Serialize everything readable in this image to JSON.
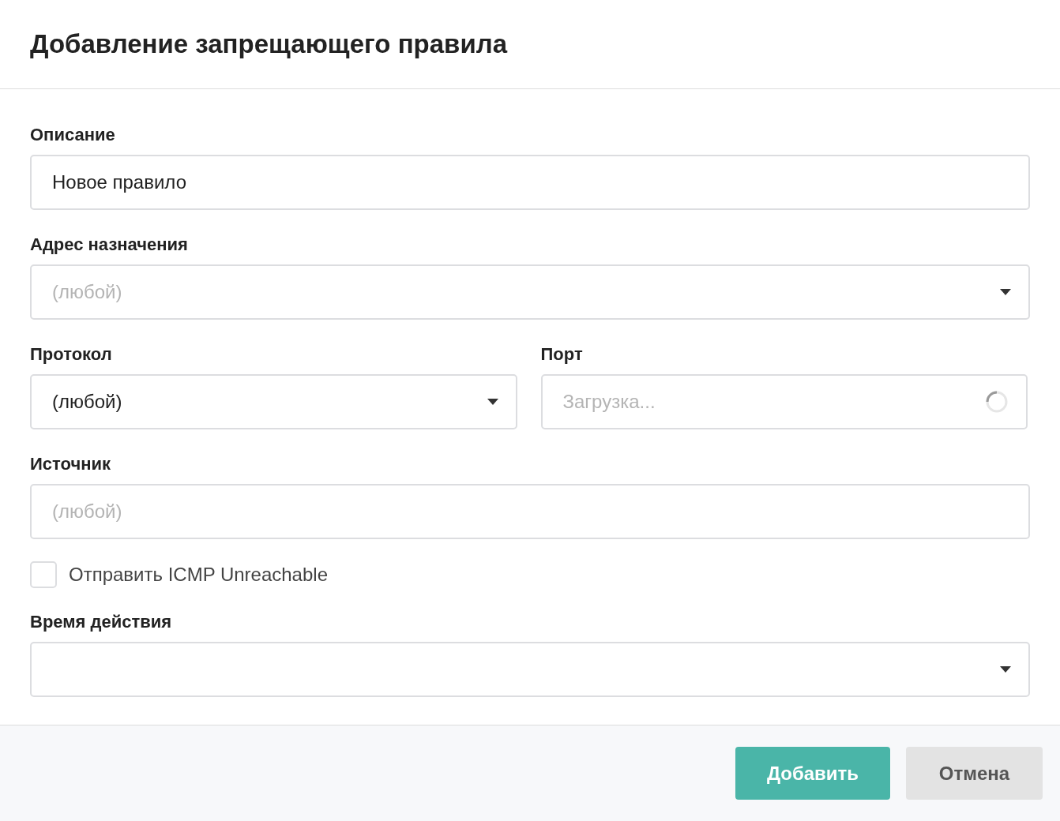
{
  "dialog": {
    "title": "Добавление запрещающего правила"
  },
  "form": [
    {
      "kind": "text",
      "label": "Описание",
      "value": "Новое правило"
    },
    {
      "kind": "select",
      "label": "Адрес назначения",
      "placeholder": "(любой)"
    },
    {
      "kind": "pair",
      "fields": [
        {
          "label": "Протокол",
          "kind": "select",
          "value": "(любой)"
        },
        {
          "label": "Порт",
          "kind": "text",
          "placeholder": "Загрузка...",
          "loading": true
        }
      ]
    },
    {
      "kind": "text",
      "label": "Источник",
      "placeholder": "(любой)"
    },
    {
      "kind": "checkbox",
      "label": "Отправить ICMP Unreachable",
      "checked": false
    },
    {
      "kind": "select",
      "label": "Время действия"
    }
  ],
  "buttons": [
    {
      "label": "Добавить",
      "kind": "primary"
    },
    {
      "label": "Отмена",
      "kind": "secondary"
    }
  ]
}
